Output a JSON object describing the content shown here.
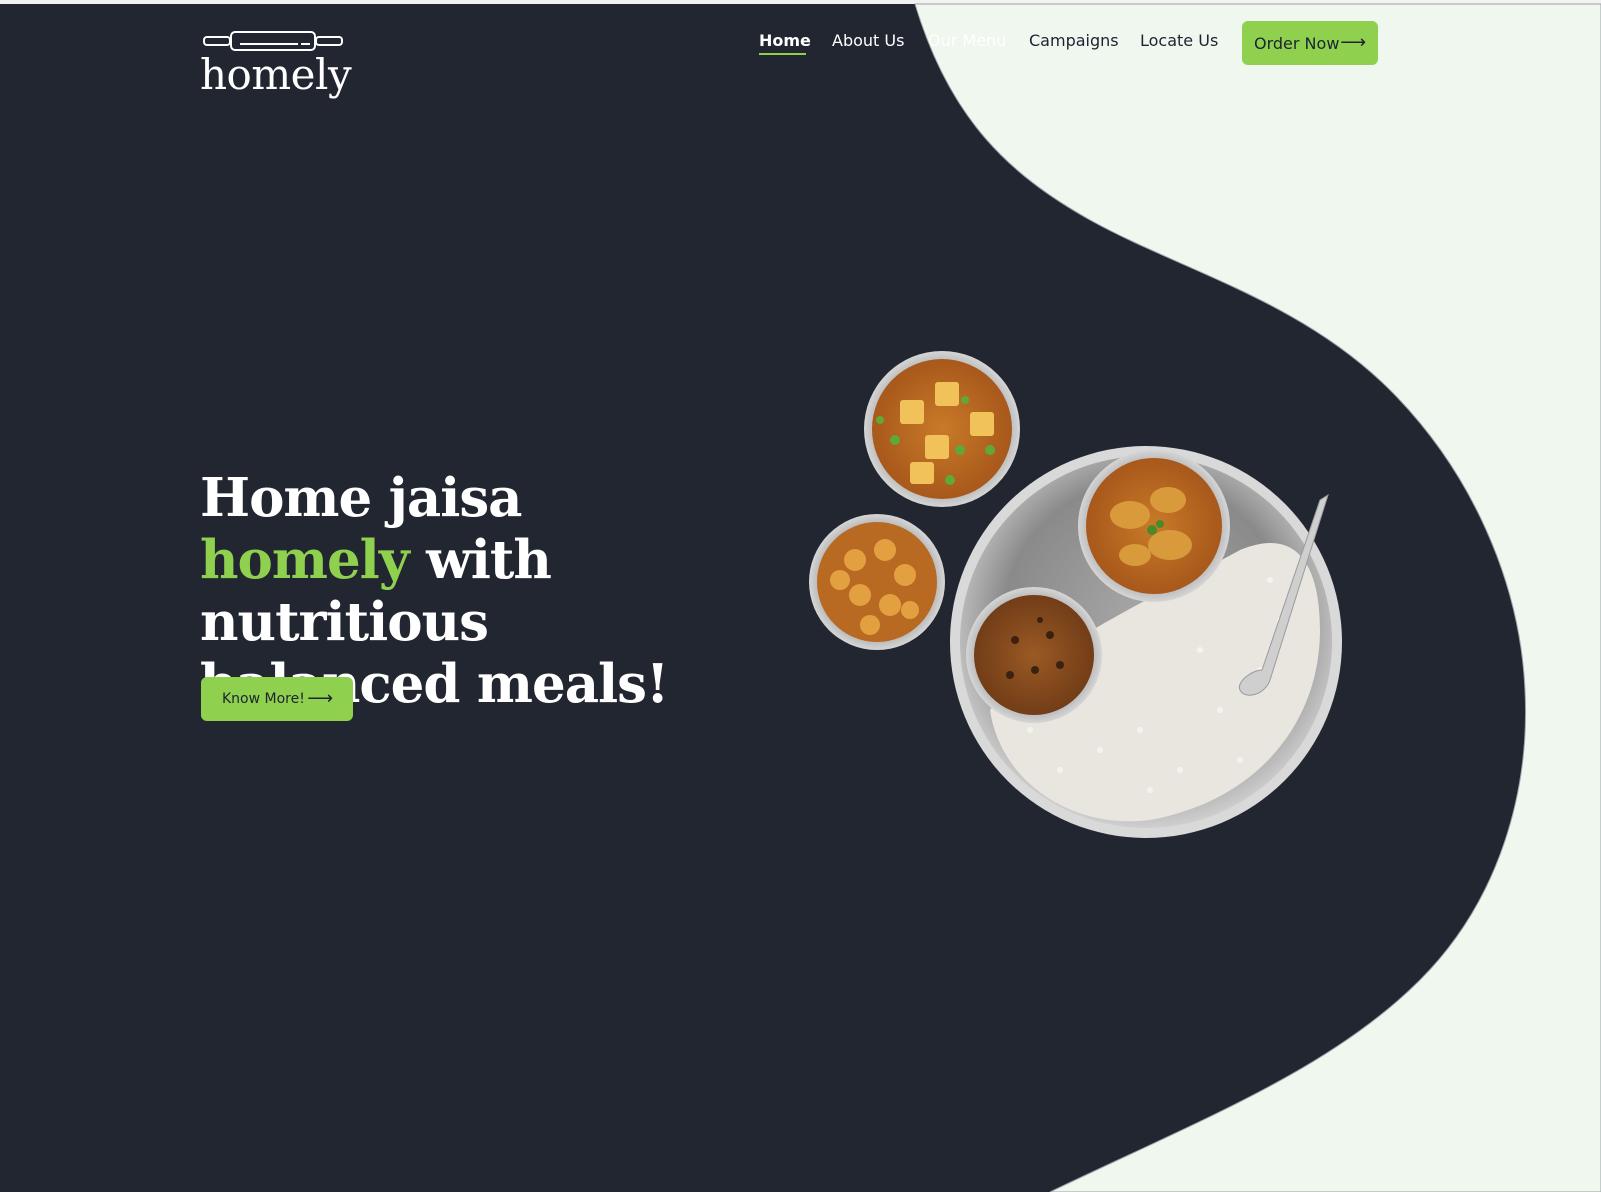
{
  "brand": {
    "name": "homely",
    "logo_icon": "rolling-pin-icon"
  },
  "nav": {
    "items": [
      {
        "label": "Home",
        "active": true
      },
      {
        "label": "About Us",
        "active": false
      },
      {
        "label": "Our Menu",
        "active": false
      },
      {
        "label": "Campaigns",
        "active": false
      },
      {
        "label": "Locate Us",
        "active": false
      }
    ],
    "cta": {
      "label": "Order Now",
      "icon": "arrow-right-icon"
    }
  },
  "hero": {
    "title_part1": "Home jaisa ",
    "title_accent": "homely",
    "title_part2": " with nutritious balanced meals!",
    "button": {
      "label": "Know More!",
      "icon": "arrow-right-icon"
    },
    "image": "thali-plate-with-curries-and-rice"
  },
  "colors": {
    "background": "#222631",
    "accent": "#8fd14f",
    "light_wave": "#eff7ee",
    "text": "#ffffff"
  }
}
